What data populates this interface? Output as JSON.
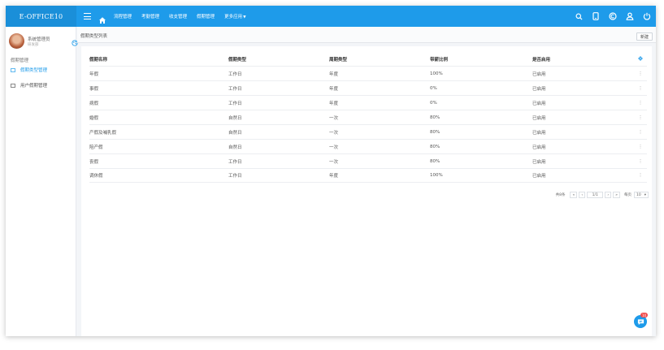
{
  "app": {
    "brand": "E-OFFICE10"
  },
  "header": {
    "menu_toggle_icon": "hamburger-icon",
    "home_icon": "home-icon",
    "nav": [
      "流程管理",
      "考勤管理",
      "收支管理",
      "假期管理"
    ],
    "more": "更多应用",
    "right_icons": [
      "search-icon",
      "mobile-icon",
      "copyright-icon",
      "user-icon",
      "power-icon"
    ]
  },
  "sidebar": {
    "user_name": "系统管理员",
    "user_role": "研发部",
    "section": "假期管理",
    "items": [
      {
        "label": "假期类型管理",
        "active": true
      },
      {
        "label": "用户假期管理",
        "active": false
      }
    ]
  },
  "breadcrumb": "假期类型列表",
  "toolbar": {
    "new_label": "新建"
  },
  "table": {
    "columns": [
      "假期名称",
      "假期类型",
      "周期类型",
      "带薪比例",
      "是否启用"
    ],
    "rows": [
      [
        "年假",
        "工作日",
        "年度",
        "100%",
        "已启用"
      ],
      [
        "事假",
        "工作日",
        "年度",
        "0%",
        "已启用"
      ],
      [
        "病假",
        "工作日",
        "年度",
        "0%",
        "已启用"
      ],
      [
        "婚假",
        "自然日",
        "一次",
        "80%",
        "已启用"
      ],
      [
        "产假及哺乳假",
        "自然日",
        "一次",
        "80%",
        "已启用"
      ],
      [
        "陪产假",
        "自然日",
        "一次",
        "80%",
        "已启用"
      ],
      [
        "丧假",
        "工作日",
        "一次",
        "80%",
        "已启用"
      ],
      [
        "调休假",
        "工作日",
        "年度",
        "100%",
        "已启用"
      ]
    ]
  },
  "pager": {
    "total": "共8条",
    "first": "«",
    "prev": "‹",
    "page": "1/1",
    "next": "›",
    "last": "»",
    "per_label": "每页",
    "per_value": "10"
  },
  "chat": {
    "badge": "10"
  },
  "colors": {
    "primary": "#1e9bea",
    "brand_bg": "#1a8fd9",
    "badge": "#f04a4a"
  }
}
